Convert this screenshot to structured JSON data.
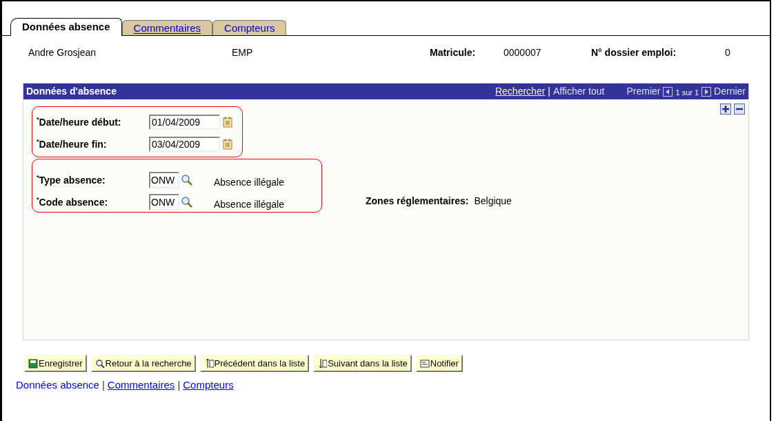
{
  "tabs": [
    {
      "label": "Données absence",
      "selected": true
    },
    {
      "label": "Commentaires",
      "selected": false
    },
    {
      "label": "Compteurs",
      "selected": false
    }
  ],
  "employee": {
    "name": "Andre Grosjean",
    "type": "EMP",
    "id_label": "Matricule:",
    "id_value": "0000007",
    "job_label": "N° dossier emploi:",
    "job_value": "0"
  },
  "panel": {
    "title": "Données d'absence",
    "search_link": "Rechercher",
    "separator": "|",
    "show_all": "Afficher tout",
    "first": "Premier",
    "count": "1 sur 1",
    "last": "Dernier",
    "groups": [
      [
        {
          "kind": "date",
          "required": "*",
          "label": "Date/heure début:",
          "value": "01/04/2009"
        },
        {
          "kind": "date",
          "required": "*",
          "label": "Date/heure fin:",
          "value": "03/04/2009"
        }
      ],
      [
        {
          "kind": "prompt",
          "required": "*",
          "label": "Type absence:",
          "value": "ONW",
          "description": "Absence illégale"
        },
        {
          "kind": "prompt",
          "required": "*",
          "label": "Code absence:",
          "value": "ONW",
          "description": "Absence illégale"
        }
      ]
    ],
    "regulatory_label": "Zones réglementaires:",
    "regulatory_value": "Belgique"
  },
  "buttons": [
    {
      "label": "Enregistrer",
      "kind": "save"
    },
    {
      "label": "Retour à la recherche",
      "kind": "search"
    },
    {
      "label": "Précédent dans la liste",
      "kind": "prev"
    },
    {
      "label": "Suivant dans la liste",
      "kind": "next"
    },
    {
      "label": "Notifier",
      "kind": "notify"
    }
  ],
  "footer_links": [
    {
      "label": "Données absence",
      "selected": true
    },
    {
      "label": "Commentaires",
      "selected": false
    },
    {
      "label": "Compteurs",
      "selected": false
    }
  ],
  "footer_separator": "|"
}
